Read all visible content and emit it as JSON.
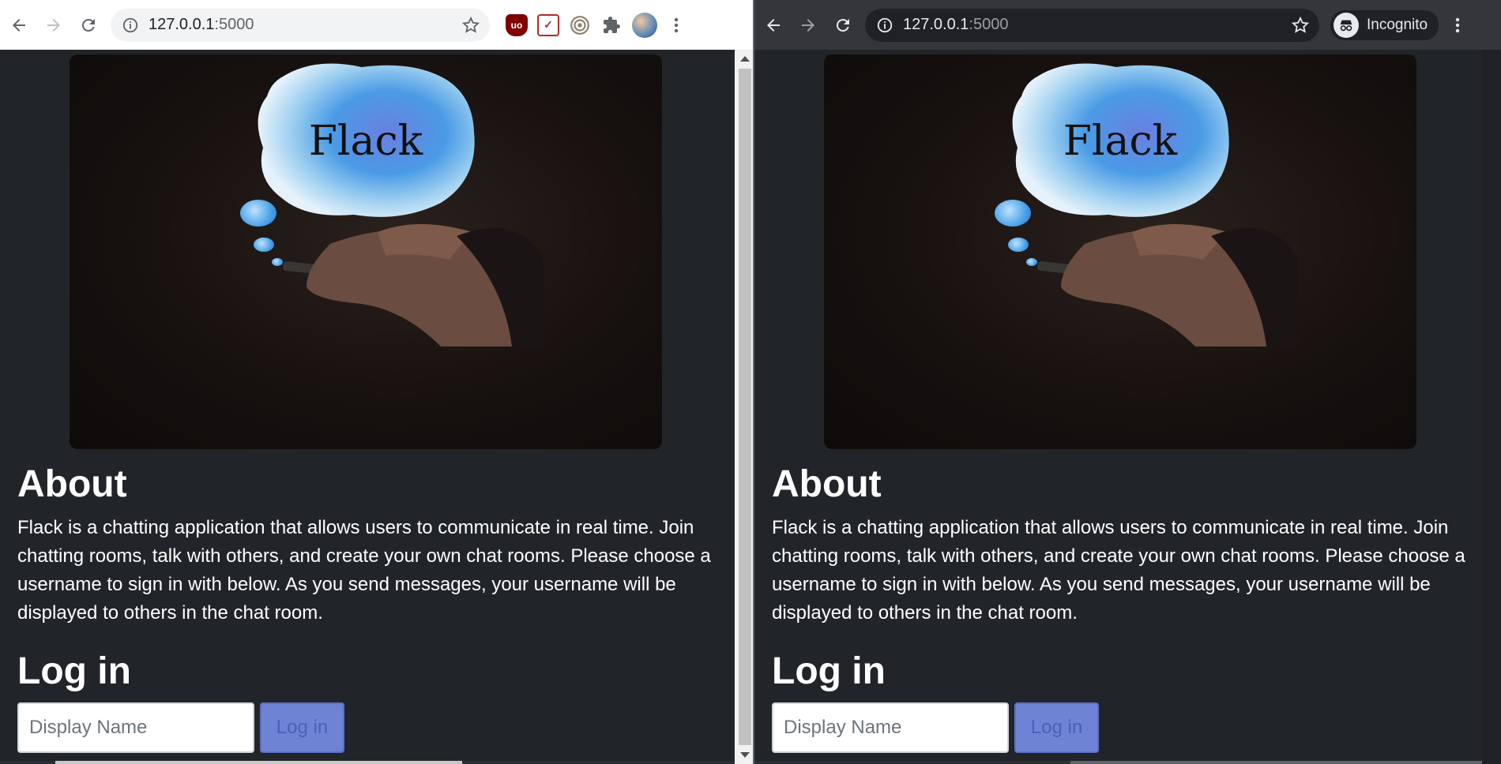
{
  "left_window": {
    "url_host": "127.0.0.1",
    "url_port": ":5000",
    "extensions": [
      "ublock-icon",
      "pocket-icon",
      "target-icon",
      "puzzle-icon",
      "avatar"
    ]
  },
  "right_window": {
    "url_host": "127.0.0.1",
    "url_port": ":5000",
    "incognito_label": "Incognito"
  },
  "page": {
    "logo_text": "Flack",
    "about_heading": "About",
    "about_text": "Flack is a chatting application that allows users to communicate in real time. Join chatting rooms, talk with others, and create your own chat rooms. Please choose a username to sign in with below. As you send messages, your username will be displayed to others in the chat room.",
    "login_heading": "Log in",
    "display_name_placeholder": "Display Name",
    "login_button": "Log in"
  },
  "colors": {
    "page_bg": "#212529",
    "button_bg": "#6f83d4",
    "incognito_toolbar": "#35363a"
  }
}
